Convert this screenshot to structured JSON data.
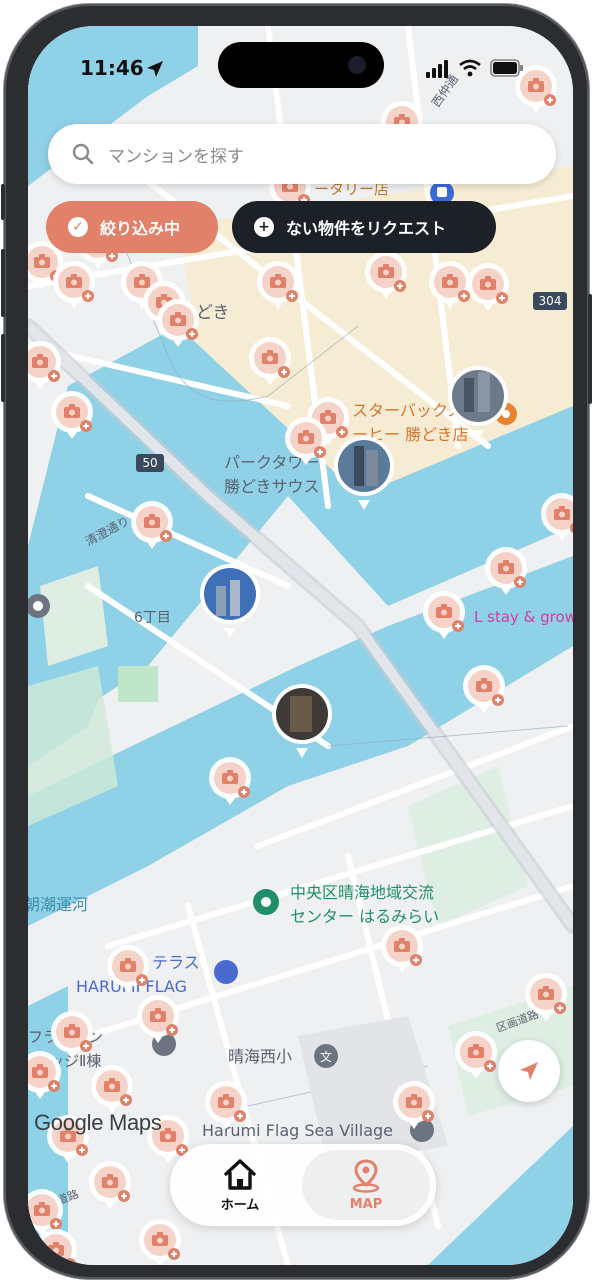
{
  "status_bar": {
    "time": "11:46"
  },
  "search": {
    "placeholder": "マンションを探す"
  },
  "filters": {
    "filter_chip": "絞り込み中",
    "request_chip": "ない物件をリクエスト"
  },
  "map_labels": {
    "starbucks": "スターバックス",
    "starbucks_line2": "ーヒー 勝どき店",
    "park_tower": "パークタワー",
    "park_tower_line2": "勝どきサウス",
    "rotary": "ータリー店",
    "nishinakadori": "西仲通",
    "doki": "どき",
    "chome6": "6丁目",
    "stay_grow": "L stay & grow",
    "community_center": "中央区晴海地域交流",
    "community_center_line2": "センター はるみらい",
    "canal": "朝潮運河",
    "terrace": "テラス",
    "harumi_flag": "HARUMI FLAG",
    "france": "フランサン",
    "village": "レッジⅡ棟",
    "school": "晴海西小",
    "sea_village": "Harumi Flag Sea Village",
    "road_304": "304",
    "road_50": "50",
    "kiyosumi": "清澄通り",
    "kuei1": "区画道路",
    "kuei2": "区画道路"
  },
  "google_logo": "Google Maps",
  "tabbar": {
    "home_label": "ホーム",
    "map_label": "MAP"
  },
  "colors": {
    "accent": "#e2816a",
    "water": "#8fd1e6",
    "dark": "#1c2128",
    "park_green": "#cfead7",
    "sand": "#f6ecd4"
  },
  "icons": {
    "search": "search-icon",
    "check": "check-icon",
    "plus": "plus-icon",
    "locate": "navigation-arrow-icon",
    "home": "home-icon",
    "map": "map-pin-icon",
    "camera_marker": "camera-marker-icon"
  }
}
